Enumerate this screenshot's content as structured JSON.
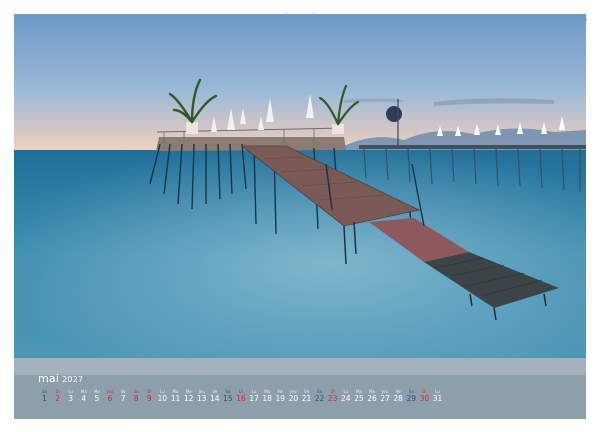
{
  "calendar": {
    "month": "mai",
    "year": "2027",
    "days": [
      {
        "wd": "Sa",
        "num": "1",
        "type": "sat"
      },
      {
        "wd": "Di",
        "num": "2",
        "type": "sun"
      },
      {
        "wd": "Lu",
        "num": "3",
        "type": ""
      },
      {
        "wd": "Ma",
        "num": "4",
        "type": ""
      },
      {
        "wd": "Me",
        "num": "5",
        "type": ""
      },
      {
        "wd": "Jeu",
        "num": "6",
        "type": "hol"
      },
      {
        "wd": "Ve",
        "num": "7",
        "type": ""
      },
      {
        "wd": "Sa",
        "num": "8",
        "type": "hol"
      },
      {
        "wd": "Di",
        "num": "9",
        "type": "sun"
      },
      {
        "wd": "Lu",
        "num": "10",
        "type": ""
      },
      {
        "wd": "Ma",
        "num": "11",
        "type": ""
      },
      {
        "wd": "Me",
        "num": "12",
        "type": ""
      },
      {
        "wd": "Jeu",
        "num": "13",
        "type": ""
      },
      {
        "wd": "Ve",
        "num": "14",
        "type": ""
      },
      {
        "wd": "Sa",
        "num": "15",
        "type": "sat"
      },
      {
        "wd": "Di",
        "num": "16",
        "type": "sun"
      },
      {
        "wd": "Lu",
        "num": "17",
        "type": ""
      },
      {
        "wd": "Ma",
        "num": "18",
        "type": ""
      },
      {
        "wd": "Me",
        "num": "19",
        "type": ""
      },
      {
        "wd": "Jeu",
        "num": "20",
        "type": ""
      },
      {
        "wd": "Ve",
        "num": "21",
        "type": ""
      },
      {
        "wd": "Sa",
        "num": "22",
        "type": "sat"
      },
      {
        "wd": "Di",
        "num": "23",
        "type": "sun"
      },
      {
        "wd": "Lu",
        "num": "24",
        "type": ""
      },
      {
        "wd": "Ma",
        "num": "25",
        "type": ""
      },
      {
        "wd": "Me",
        "num": "26",
        "type": ""
      },
      {
        "wd": "Jeu",
        "num": "27",
        "type": ""
      },
      {
        "wd": "Ve",
        "num": "28",
        "type": ""
      },
      {
        "wd": "Sa",
        "num": "29",
        "type": "sat"
      },
      {
        "wd": "Di",
        "num": "30",
        "type": "sun"
      },
      {
        "wd": "Lu",
        "num": "31",
        "type": ""
      }
    ]
  },
  "colors": {
    "sky_top": "#6f9cc9",
    "sky_horizon": "#f2d6c0",
    "sea": "#2f7fa3",
    "calendar_bar": "#8e9fac",
    "sunday_red": "#cf2b36",
    "saturday_blue": "#1f4f86"
  }
}
